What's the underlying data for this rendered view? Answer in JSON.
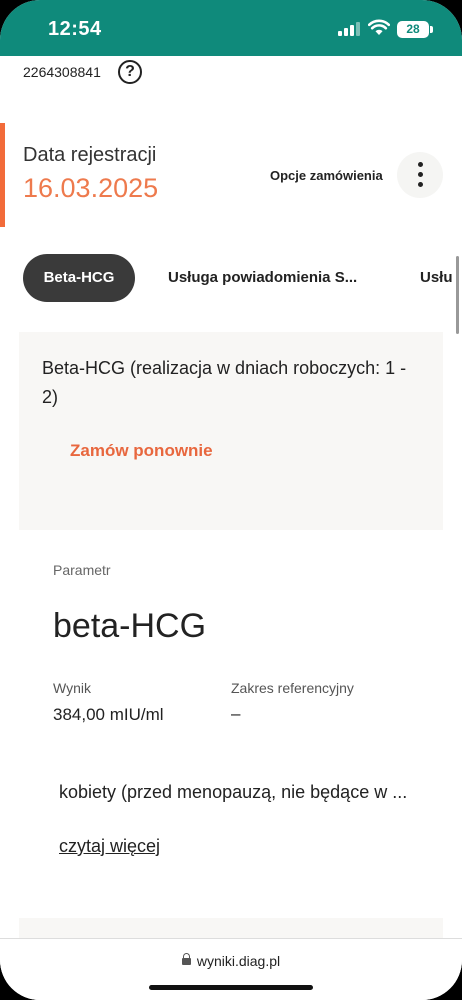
{
  "status_bar": {
    "time": "12:54",
    "battery": "28"
  },
  "order": {
    "id": "2264308841"
  },
  "registration": {
    "label": "Data rejestracji",
    "date": "16.03.2025"
  },
  "order_options": {
    "label": "Opcje zamówienia"
  },
  "tabs": [
    {
      "label": "Beta-HCG",
      "active": true
    },
    {
      "label": "Usługa powiadomienia S...",
      "active": false
    },
    {
      "label": "Usłu",
      "active": false
    }
  ],
  "service_card": {
    "title": "Beta-HCG (realizacja w dniach roboczych: 1 - 2)",
    "reorder_label": "Zamów ponownie"
  },
  "result": {
    "param_label": "Parametr",
    "param_name": "beta-HCG",
    "result_label": "Wynik",
    "result_value": "384,00 mIU/ml",
    "ref_label": "Zakres referencyjny",
    "ref_value": "–",
    "description": "kobiety (przed menopauzą, nie będące w ...",
    "read_more": "czytaj więcej"
  },
  "browser": {
    "url": "wyniki.diag.pl"
  },
  "colors": {
    "status_bar": "#0f8a7b",
    "accent": "#f26b3a",
    "date": "#ee7a4d",
    "reorder": "#e8673e",
    "active_tab": "#3a3a3a"
  }
}
